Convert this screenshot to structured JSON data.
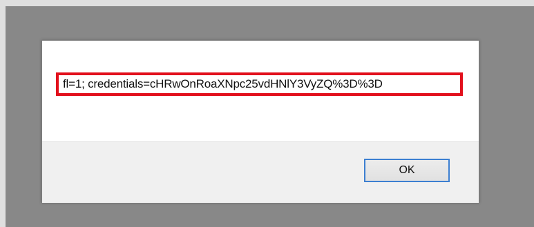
{
  "dialog": {
    "message": "fl=1; credentials=cHRwOnRoaXNpc25vdHNlY3VyZQ%3D%3D",
    "ok_label": "OK"
  },
  "colors": {
    "overlay": "#888888",
    "highlight": "#e2101c",
    "button_focus": "#3c7fd1"
  }
}
